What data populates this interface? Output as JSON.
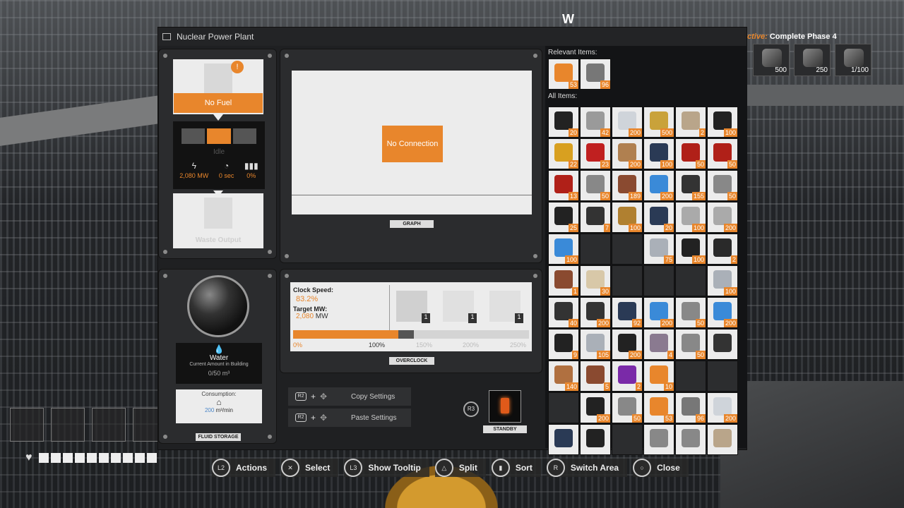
{
  "hud": {
    "compass_heading": "W",
    "objective": {
      "prefix": "ctive:",
      "title": "Complete Phase 4",
      "items": [
        {
          "icon": "motor-icon",
          "count": "500"
        },
        {
          "icon": "computer-icon",
          "count": "250"
        },
        {
          "icon": "supercomputer-icon",
          "count": "1/100"
        }
      ]
    },
    "prompts": [
      {
        "button": "L2",
        "label": "Actions"
      },
      {
        "button": "✕",
        "label": "Select"
      },
      {
        "button": "L3",
        "label": "Show Tooltip"
      },
      {
        "button": "△",
        "label": "Split"
      },
      {
        "button": "▮",
        "label": "Sort"
      },
      {
        "button": "R",
        "label": "Switch Area"
      },
      {
        "button": "○",
        "label": "Close"
      }
    ]
  },
  "window": {
    "title": "Nuclear Power Plant"
  },
  "fuel": {
    "no_fuel_label": "No Fuel",
    "status": "Idle",
    "power": "2,080 MW",
    "time": "0 sec",
    "productivity": "0%",
    "waste_label": "Waste Output"
  },
  "graph": {
    "no_connection": "No Connection",
    "tag": "GRAPH"
  },
  "fluid": {
    "name": "Water",
    "current_label": "Current Amount in Building",
    "amount": "0/50 m³",
    "consumption_label": "Consumption:",
    "consumption_value": "200",
    "consumption_unit": " m³/min",
    "tag": "FLUID STORAGE"
  },
  "overclock": {
    "clock_label": "Clock Speed:",
    "clock_value": "83.2%",
    "target_label": "Target MW:",
    "target_value": "2,080",
    "target_unit": " MW",
    "clock_fraction": 0.832,
    "shards": [
      "1",
      "1",
      "1"
    ],
    "ticks": [
      "0%",
      "100%",
      "150%",
      "200%",
      "250%"
    ],
    "tag": "OVERCLOCK"
  },
  "settings": {
    "copy_button": "R2",
    "copy_label": "Copy Settings",
    "paste_button": "R2",
    "paste_label": "Paste Settings",
    "standby_button": "R3",
    "standby_tag": "STANDBY"
  },
  "inventory": {
    "relevant_label": "Relevant Items:",
    "all_label": "All Items:",
    "relevant": [
      {
        "color": "#e8862c",
        "qty": "53"
      },
      {
        "color": "#777777",
        "qty": "96"
      }
    ],
    "rows": [
      [
        {
          "c": "#222222",
          "q": "20"
        },
        {
          "c": "#9a9a9a",
          "q": "42"
        },
        {
          "c": "#cfd4da",
          "q": "200"
        },
        {
          "c": "#c9a23a",
          "q": "500"
        },
        {
          "c": "#b9a58a",
          "q": "2"
        },
        {
          "c": "#222222",
          "q": "100"
        }
      ],
      [
        {
          "c": "#d8a020",
          "q": "22"
        },
        {
          "c": "#c02020",
          "q": "23"
        },
        {
          "c": "#b08050",
          "q": "200"
        },
        {
          "c": "#2a3a55",
          "q": "100"
        },
        {
          "c": "#b02018",
          "q": "50"
        },
        {
          "c": "#b02018",
          "q": "50"
        }
      ],
      [
        {
          "c": "#b02018",
          "q": "13"
        },
        {
          "c": "#888888",
          "q": "50"
        },
        {
          "c": "#8a4a30",
          "q": "189"
        },
        {
          "c": "#3a8ad8",
          "q": "200"
        },
        {
          "c": "#333333",
          "q": "155"
        },
        {
          "c": "#888888",
          "q": "50"
        }
      ],
      [
        {
          "c": "#222222",
          "q": "25"
        },
        {
          "c": "#333333",
          "q": "7"
        },
        {
          "c": "#b08030",
          "q": "100"
        },
        {
          "c": "#2a3a55",
          "q": "20"
        },
        {
          "c": "#aaaaaa",
          "q": "100"
        },
        {
          "c": "#aaaaaa",
          "q": "200"
        }
      ],
      [
        {
          "c": "#3a8ad8",
          "q": "100"
        },
        {
          "c": "",
          "q": ""
        },
        {
          "c": "",
          "q": ""
        },
        {
          "c": "#aab0b8",
          "q": "75"
        },
        {
          "c": "#222222",
          "q": "100"
        },
        {
          "c": "#2a2a2a",
          "q": "2"
        }
      ],
      [
        {
          "c": "#8a4a30",
          "q": "1"
        },
        {
          "c": "#d8c8a8",
          "q": "30"
        },
        {
          "c": "",
          "q": ""
        },
        {
          "c": "",
          "q": ""
        },
        {
          "c": "",
          "q": ""
        },
        {
          "c": "#aab0b8",
          "q": "100"
        }
      ],
      [
        {
          "c": "#333333",
          "q": "40"
        },
        {
          "c": "#333333",
          "q": "200"
        },
        {
          "c": "#2a3a55",
          "q": "92"
        },
        {
          "c": "#3a8ad8",
          "q": "200"
        },
        {
          "c": "#888888",
          "q": "50"
        },
        {
          "c": "#3a8ad8",
          "q": "200"
        }
      ],
      [
        {
          "c": "#222222",
          "q": "9"
        },
        {
          "c": "#aab0b8",
          "q": "105"
        },
        {
          "c": "#222222",
          "q": "200"
        },
        {
          "c": "#8a7a90",
          "q": "4"
        },
        {
          "c": "#888888",
          "q": "50"
        },
        {
          "c": "#333333",
          "q": ""
        }
      ],
      [
        {
          "c": "#b07040",
          "q": "140"
        },
        {
          "c": "#8a4a30",
          "q": "5"
        },
        {
          "c": "#7a2aa8",
          "q": "2"
        },
        {
          "c": "#e8862c",
          "q": "10"
        },
        {
          "c": "",
          "q": ""
        },
        {
          "c": "",
          "q": ""
        }
      ],
      [
        {
          "c": "",
          "q": ""
        },
        {
          "c": "#222222",
          "q": "200"
        },
        {
          "c": "#888888",
          "q": "50"
        },
        {
          "c": "#e8862c",
          "q": "53"
        },
        {
          "c": "#777777",
          "q": "96"
        },
        {
          "c": "#cfd4da",
          "q": "200"
        }
      ],
      [
        {
          "c": "#2a3a55",
          "q": ""
        },
        {
          "c": "#222222",
          "q": ""
        },
        {
          "c": "",
          "q": ""
        },
        {
          "c": "#888888",
          "q": ""
        },
        {
          "c": "#888888",
          "q": ""
        },
        {
          "c": "#b9a58a",
          "q": ""
        }
      ]
    ]
  }
}
